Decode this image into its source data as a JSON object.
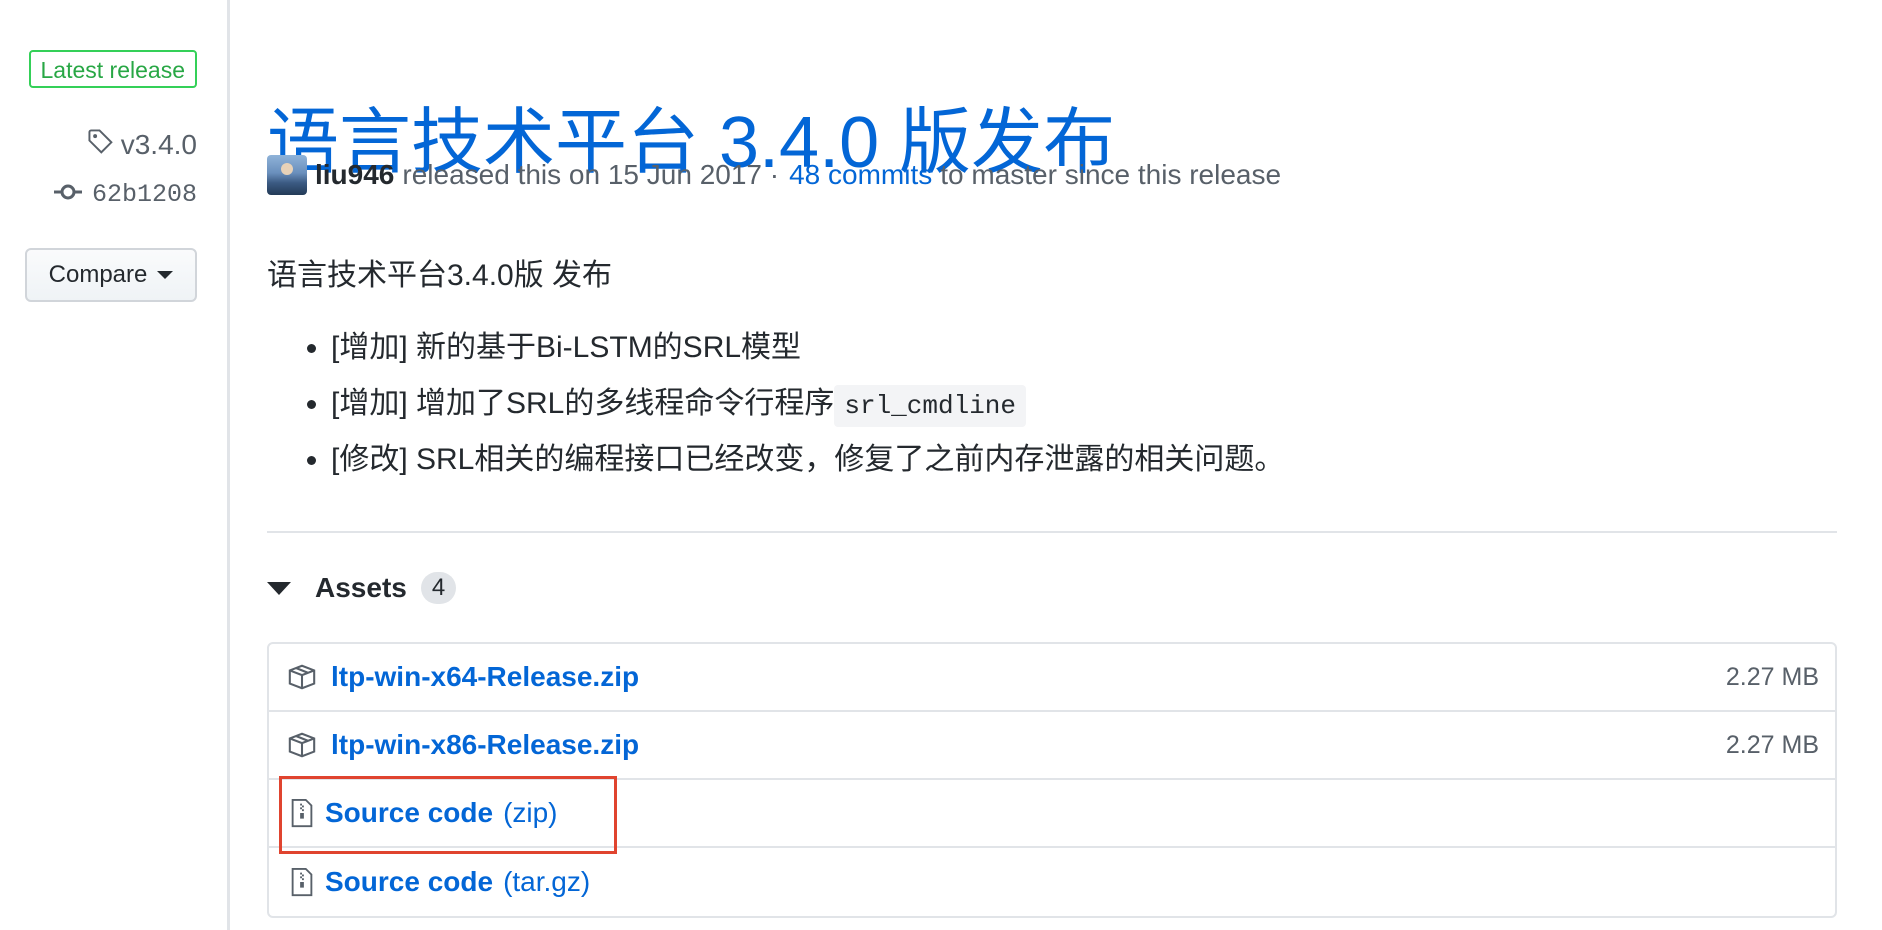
{
  "sidebar": {
    "latest_label": "Latest release",
    "tag": "v3.4.0",
    "commit": "62b1208",
    "compare_label": "Compare"
  },
  "release": {
    "title": "语言技术平台 3.4.0 版发布",
    "author": "liu946",
    "released_text": "released this on 15 Jun 2017 ·",
    "commits_link": "48 commits",
    "commits_suffix": "to master since this release",
    "body_heading": "语言技术平台3.4.0版 发布",
    "notes": [
      {
        "text": "[增加] 新的基于Bi-LSTM的SRL模型"
      },
      {
        "text": "[增加] 增加了SRL的多线程命令行程序",
        "code": "srl_cmdline"
      },
      {
        "text": "[修改] SRL相关的编程接口已经改变，修复了之前内存泄露的相关问题。"
      }
    ]
  },
  "assets": {
    "label": "Assets",
    "count": "4",
    "items": [
      {
        "name": "ltp-win-x64-Release.zip",
        "suffix": "",
        "size": "2.27 MB",
        "icon": "package-icon"
      },
      {
        "name": "ltp-win-x86-Release.zip",
        "suffix": "",
        "size": "2.27 MB",
        "icon": "package-icon"
      },
      {
        "name": "Source code",
        "suffix": "(zip)",
        "size": "",
        "icon": "file-zip-icon"
      },
      {
        "name": "Source code",
        "suffix": "(tar.gz)",
        "size": "",
        "icon": "file-zip-icon"
      }
    ]
  },
  "colors": {
    "link": "#0366d6",
    "latest_green": "#28a745",
    "highlight_red": "#e0442f"
  }
}
